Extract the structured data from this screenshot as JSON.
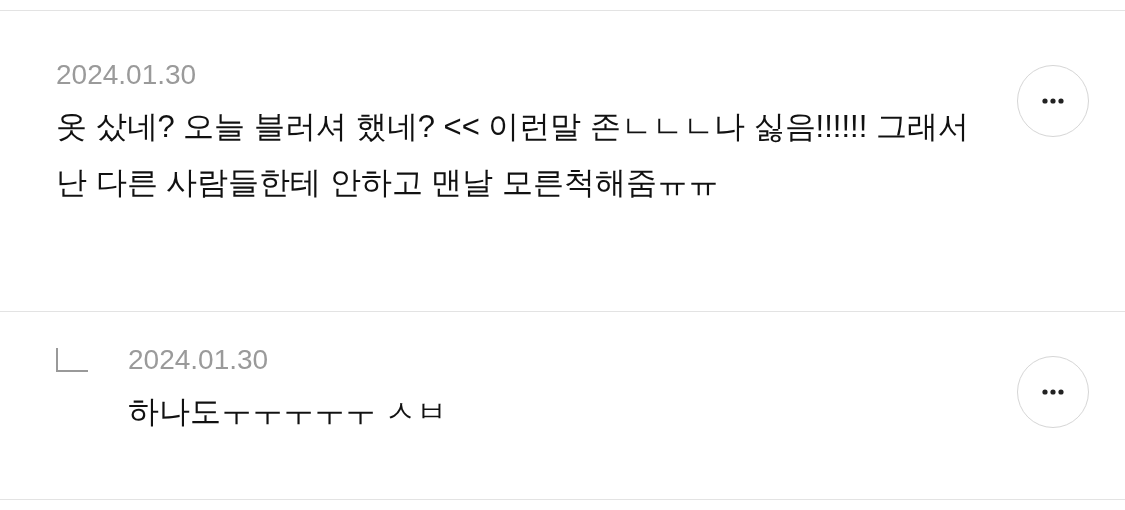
{
  "comments": [
    {
      "kind": "comment",
      "date": "2024.01.30",
      "text": "옷 샀네? 오늘 블러셔 했네? << 이런말 존ㄴㄴㄴ나 싫음!!!!!! 그래서 난 다른 사람들한테 안하고 맨날 모른척해줌ㅠㅠ"
    },
    {
      "kind": "reply",
      "date": "2024.01.30",
      "text": "하나도ㅜㅜㅜㅜㅜ ㅅㅂ"
    }
  ]
}
